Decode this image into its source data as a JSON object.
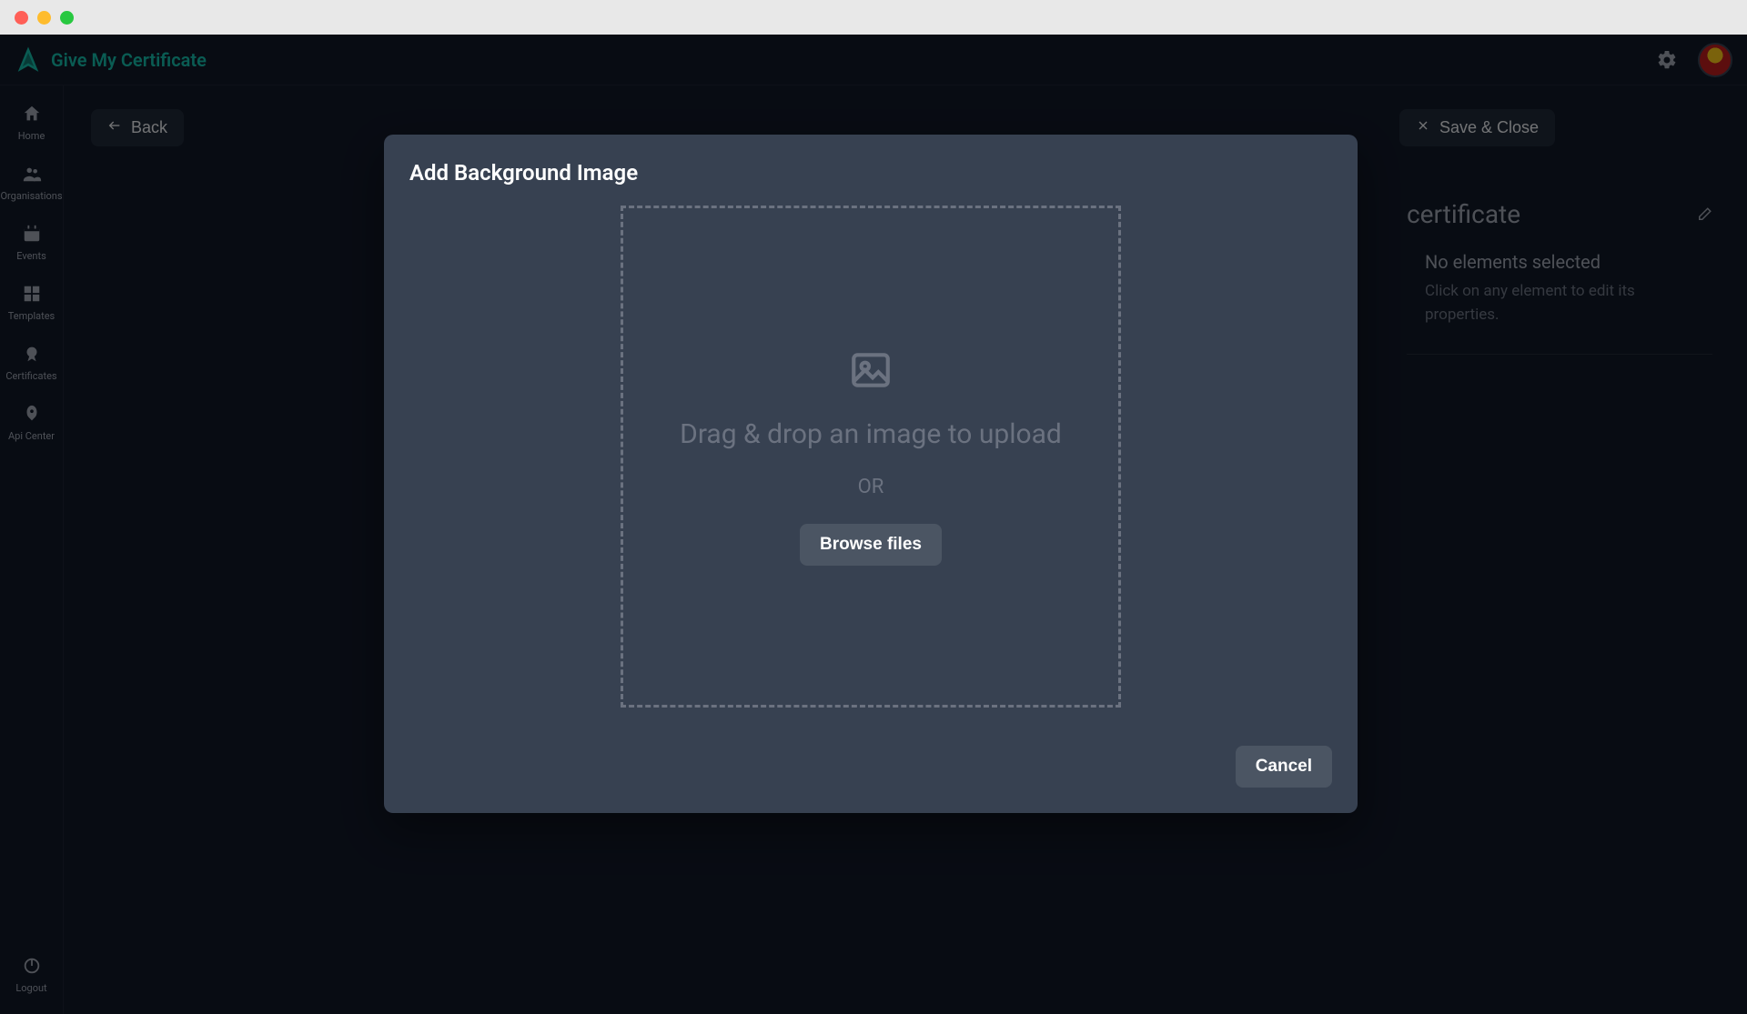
{
  "brand": {
    "title": "Give My Certificate"
  },
  "sidebar": {
    "items": [
      {
        "label": "Home"
      },
      {
        "label": "Organisations"
      },
      {
        "label": "Events"
      },
      {
        "label": "Templates"
      },
      {
        "label": "Certificates"
      },
      {
        "label": "Api Center"
      }
    ],
    "logout_label": "Logout"
  },
  "toolbar": {
    "back_label": "Back",
    "save_close_label": "Save & Close"
  },
  "inspector": {
    "title": "certificate",
    "no_selection_title": "No elements selected",
    "no_selection_desc": "Click on any element to edit its properties."
  },
  "modal": {
    "title": "Add Background Image",
    "drop_text": "Drag & drop an image to upload",
    "or_text": "OR",
    "browse_label": "Browse files",
    "cancel_label": "Cancel"
  }
}
